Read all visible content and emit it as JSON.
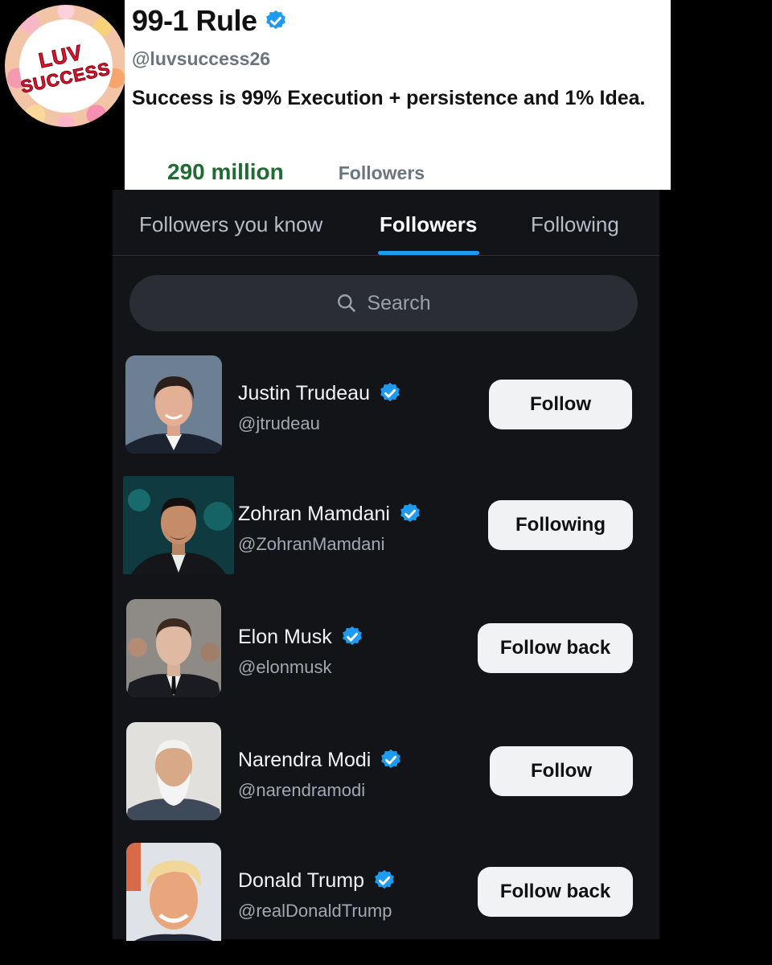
{
  "logo": {
    "line1": "LUV",
    "line2": "SUCCESS"
  },
  "profile": {
    "name": "99-1 Rule",
    "handle": "@luvsuccess26",
    "bio": "Success is 99% Execution + persistence and 1% Idea.",
    "followers_count": "290 million",
    "followers_label": "Followers"
  },
  "tabs": [
    {
      "label": "Followers you know",
      "active": false
    },
    {
      "label": "Followers",
      "active": true
    },
    {
      "label": "Following",
      "active": false
    }
  ],
  "search": {
    "placeholder": "Search",
    "icon": "search-icon"
  },
  "users": [
    {
      "name": "Justin Trudeau",
      "handle": "@jtrudeau",
      "verified": true,
      "button": "Follow"
    },
    {
      "name": "Zohran Mamdani",
      "handle": "@ZohranMamdani",
      "verified": true,
      "button": "Following"
    },
    {
      "name": "Elon Musk",
      "handle": "@elonmusk",
      "verified": true,
      "button": "Follow back"
    },
    {
      "name": "Narendra Modi",
      "handle": "@narendramodi",
      "verified": true,
      "button": "Follow"
    },
    {
      "name": "Donald Trump",
      "handle": "@realDonaldTrump",
      "verified": true,
      "button": "Follow back"
    }
  ],
  "colors": {
    "accent": "#1d9bf0",
    "panel_bg": "#121418",
    "button_bg": "#f1f2f4",
    "followers_count": "#1f6b33"
  }
}
